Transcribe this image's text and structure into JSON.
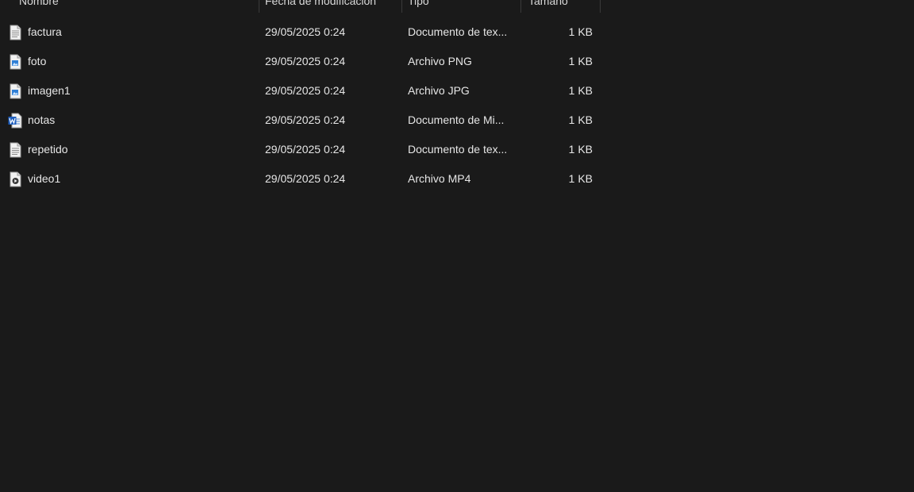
{
  "columns": {
    "name": "Nombre",
    "date": "Fecha de modificación",
    "type": "Tipo",
    "size": "Tamaño"
  },
  "files": [
    {
      "name": "factura",
      "date": "29/05/2025 0:24",
      "type": "Documento de tex...",
      "size": "1 KB",
      "icon": "text-document-icon"
    },
    {
      "name": "foto",
      "date": "29/05/2025 0:24",
      "type": "Archivo PNG",
      "size": "1 KB",
      "icon": "image-file-icon"
    },
    {
      "name": "imagen1",
      "date": "29/05/2025 0:24",
      "type": "Archivo JPG",
      "size": "1 KB",
      "icon": "image-file-icon"
    },
    {
      "name": "notas",
      "date": "29/05/2025 0:24",
      "type": "Documento de Mi...",
      "size": "1 KB",
      "icon": "word-document-icon"
    },
    {
      "name": "repetido",
      "date": "29/05/2025 0:24",
      "type": "Documento de tex...",
      "size": "1 KB",
      "icon": "text-document-icon"
    },
    {
      "name": "video1",
      "date": "29/05/2025 0:24",
      "type": "Archivo MP4",
      "size": "1 KB",
      "icon": "video-file-icon"
    }
  ]
}
